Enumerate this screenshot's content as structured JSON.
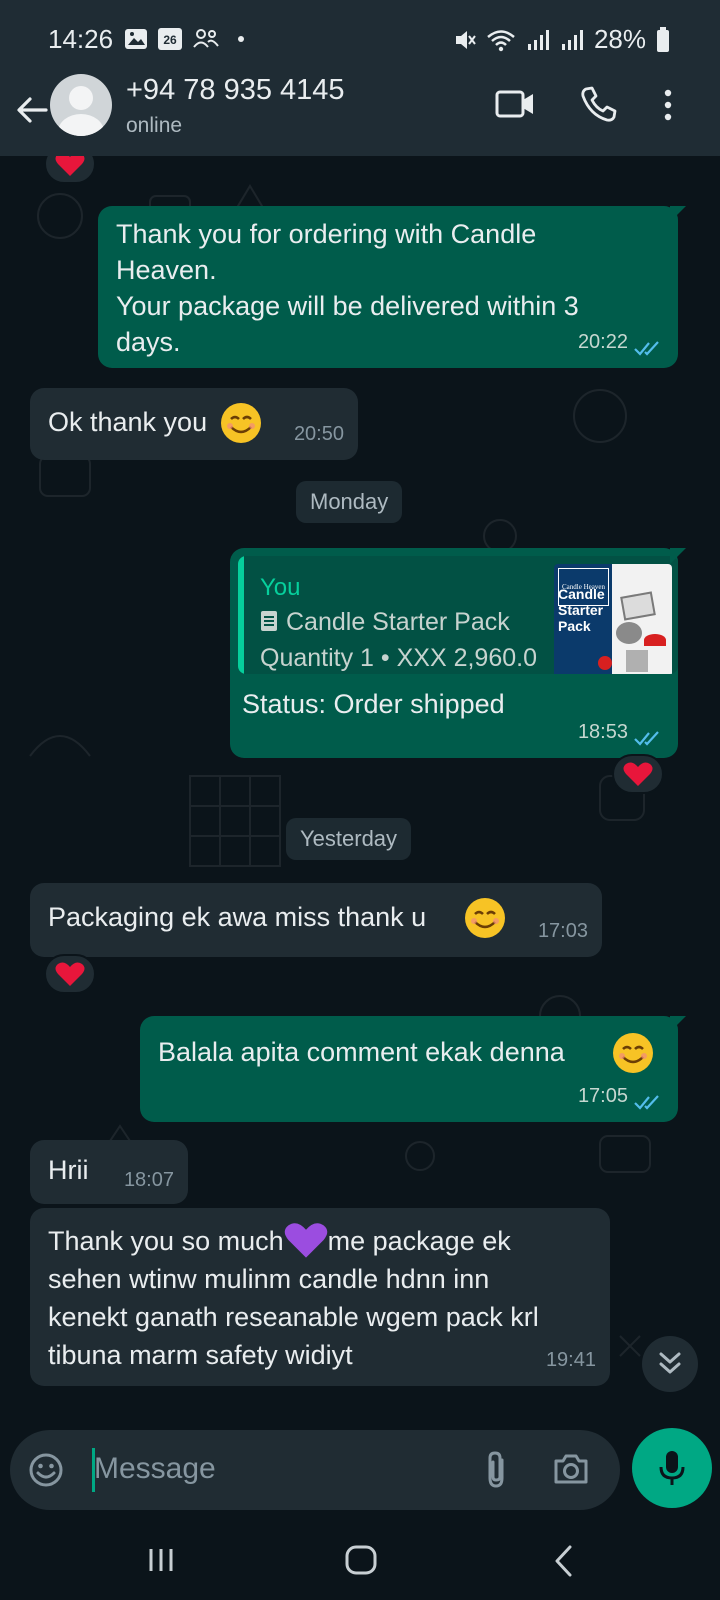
{
  "status_bar": {
    "time": "14:26",
    "calendar_day": "26",
    "battery": "28%",
    "icons": [
      "gallery-icon",
      "calendar-icon",
      "people-icon",
      "dot-icon",
      "mute-icon",
      "wifi-icon",
      "signal-icon",
      "signal-icon",
      "battery-icon"
    ]
  },
  "header": {
    "contact": "+94 78 935 4145",
    "status": "online",
    "icons": [
      "back-arrow-icon",
      "avatar",
      "video-call-icon",
      "phone-icon",
      "more-vert-icon"
    ]
  },
  "messages": [
    {
      "direction": "out",
      "lines": [
        "Thank you for ordering with Candle",
        "Heaven.",
        "Your package will be delivered within 3",
        "days."
      ],
      "time": "20:22",
      "read": true
    },
    {
      "direction": "in",
      "text": "Ok thank you",
      "emoji": "smile",
      "time": "20:50"
    },
    {
      "direction": "out",
      "quote": {
        "author": "You",
        "title": "Candle Starter Pack",
        "detail": "Quantity 1 • XXX 2,960.0",
        "thumb_title": [
          "Candle",
          "Starter",
          "Pack"
        ],
        "thumb_header": "Candle Heaven"
      },
      "text": "Status: Order shipped",
      "time": "18:53",
      "read": true,
      "reaction": "heart"
    },
    {
      "direction": "in",
      "text": "Packaging ek awa miss thank u",
      "emoji": "smile",
      "time": "17:03",
      "reaction": "heart"
    },
    {
      "direction": "out",
      "text": "Balala apita comment ekak denna",
      "emoji": "smile",
      "time": "17:05",
      "read": true
    },
    {
      "direction": "in",
      "text": "Hrii",
      "time": "18:07"
    },
    {
      "direction": "in",
      "lines": [
        "Thank you so much",
        "me package ek",
        "sehen wtinw mulinm candle hdnn inn",
        "kenekt ganath reseanable wgem pack krl",
        "tibuna marm safety widiyt"
      ],
      "emoji": "purple-heart",
      "time": "19:41"
    }
  ],
  "day_chips": {
    "monday": "Monday",
    "yesterday": "Yesterday"
  },
  "top_reaction": "heart",
  "input": {
    "placeholder": "Message"
  },
  "colors": {
    "outgoing": "#005c4b",
    "incoming": "#202c33",
    "accent": "#00a884",
    "background": "#0b141a",
    "read_ticks": "#53bdeb"
  }
}
